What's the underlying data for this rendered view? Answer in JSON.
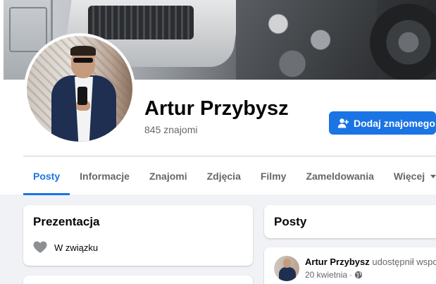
{
  "profile": {
    "name": "Artur Przybysz",
    "friends": "845 znajomi",
    "add_friend_label": "Dodaj znajomego",
    "icons": {
      "add_friend": "person-plus-icon"
    }
  },
  "tabs": [
    {
      "label": "Posty",
      "active": true
    },
    {
      "label": "Informacje",
      "active": false
    },
    {
      "label": "Znajomi",
      "active": false
    },
    {
      "label": "Zdjęcia",
      "active": false
    },
    {
      "label": "Filmy",
      "active": false
    },
    {
      "label": "Zameldowania",
      "active": false
    },
    {
      "label": "Więcej",
      "active": false,
      "icon": "caret-down-icon"
    }
  ],
  "intro": {
    "title": "Prezentacja",
    "relationship": "W związku",
    "icon": "heart-icon"
  },
  "posts_section": {
    "title": "Posty"
  },
  "post": {
    "author": "Artur Przybysz",
    "action": "udostępnił wspo",
    "date": "20 kwietnia",
    "separator": "·",
    "privacy_icon": "globe-icon"
  },
  "colors": {
    "accent": "#1b74e4",
    "page_background": "#f0f2f5",
    "secondary_text": "#65676b"
  }
}
